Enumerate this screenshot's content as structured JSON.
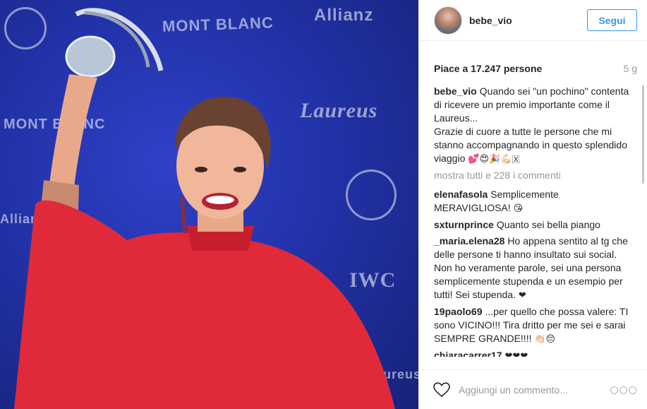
{
  "post": {
    "username": "bebe_vio",
    "follow_label": "Segui",
    "likes_text": "Piace a 17.247 persone",
    "time_ago": "5 g",
    "caption": {
      "user": "bebe_vio",
      "text": "Quando sei \"un pochino\" contenta di ricevere un premio importante come il Laureus...",
      "text2": "Grazie di cuore a tutte le persone che mi stanno accompagnando in questo splendido viaggio",
      "emoji": "💕😍🎉💪🏻🇽"
    },
    "more_comments": "mostra tutti e 228 i commenti",
    "comments": [
      {
        "user": "elenafasola",
        "text": "Semplicemente MERAVIGLIOSA!",
        "emoji": "😘"
      },
      {
        "user": "sxturnprince",
        "text": "Quanto sei bella piango",
        "emoji": ""
      },
      {
        "user": "_maria.elena28",
        "text": "Ho appena sentito al tg che delle persone ti hanno insultato sui social. Non ho veramente parole, sei una persona semplicemente stupenda e un esempio per tutti! Sei stupenda.",
        "emoji": "❤"
      },
      {
        "user": "19paolo69",
        "text": "...per quello che possa valere: TI sono VICINO!!! Tira dritto per me sei e sarai SEMPRE GRANDE!!!!",
        "emoji": "👏🏻😔"
      },
      {
        "user": "chiaracarrer17",
        "text": "",
        "emoji": "❤❤❤"
      }
    ],
    "comment_placeholder": "Aggiungi un commento...",
    "options_glyph": "○○○",
    "icons": {
      "like": "heart-icon",
      "options": "more-options-icon"
    }
  },
  "photo": {
    "watermarks": [
      "MONT BLANC",
      "Allianz",
      "Laureus",
      "MONT BLANC",
      "IWC",
      "Allianz",
      "Laureus"
    ],
    "colors": {
      "background": "#2232a8",
      "dress": "#e02a3a"
    }
  }
}
